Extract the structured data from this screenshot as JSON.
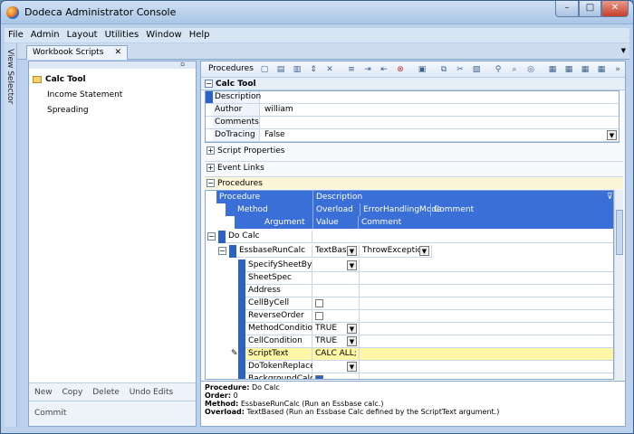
{
  "window": {
    "title": "Dodeca Administrator Console",
    "min": "–",
    "max": "□",
    "close": "✕"
  },
  "menu": [
    "File",
    "Admin",
    "Layout",
    "Utilities",
    "Window",
    "Help"
  ],
  "side_strip": "View Selector",
  "doc_tab": {
    "label": "Workbook Scripts",
    "close": "✕"
  },
  "tree": {
    "root": "Calc Tool",
    "items": [
      "Income Statement",
      "Spreading"
    ]
  },
  "left_actions": [
    "New",
    "Copy",
    "Delete",
    "Undo Edits"
  ],
  "commit": "Commit",
  "toolbar": {
    "label": "Procedures"
  },
  "header": {
    "title": "Calc Tool"
  },
  "props": [
    {
      "key": "Description",
      "value": ""
    },
    {
      "key": "Author",
      "value": "william"
    },
    {
      "key": "Comments",
      "value": ""
    },
    {
      "key": "DoTracing",
      "value": "False"
    }
  ],
  "sections": {
    "script_properties": "Script Properties",
    "event_links": "Event Links",
    "procedures": "Procedures"
  },
  "grid_header": {
    "row1": [
      "Procedure",
      "Description"
    ],
    "row2": [
      "Method",
      "Overload",
      "ErrorHandlingMode",
      "Comment"
    ],
    "row3": [
      "Argument",
      "Value",
      "Comment"
    ]
  },
  "proc": {
    "name": "Do Calc"
  },
  "method": {
    "name": "EssbaseRunCalc",
    "overload": "TextBas",
    "error_mode": "ThrowException"
  },
  "args": [
    {
      "name": "SpecifySheetBy",
      "value": "",
      "type": "dropdown"
    },
    {
      "name": "SheetSpec",
      "value": "",
      "type": "text"
    },
    {
      "name": "Address",
      "value": "",
      "type": "text"
    },
    {
      "name": "CellByCell",
      "value": "",
      "type": "checkbox"
    },
    {
      "name": "ReverseOrder",
      "value": "",
      "type": "checkbox"
    },
    {
      "name": "MethodCondition",
      "value": "TRUE",
      "type": "dropdown"
    },
    {
      "name": "CellCondition",
      "value": "TRUE",
      "type": "dropdown"
    },
    {
      "name": "ScriptText",
      "value": "CALC ALL;",
      "type": "text",
      "selected": true
    },
    {
      "name": "DoTokenReplace",
      "value": "",
      "type": "dropdown"
    },
    {
      "name": "BackgroundCalc",
      "value": "",
      "type": "checkbox-checked"
    }
  ],
  "status": {
    "procedure_label": "Procedure:",
    "procedure": "Do Calc",
    "order_label": "Order:",
    "order": "0",
    "method_label": "Method:",
    "method": "EssbaseRunCalc (Run an Essbase calc.)",
    "overload_label": "Overload:",
    "overload": "TextBased (Run an Essbase Calc defined by the ScriptText argument.)"
  }
}
